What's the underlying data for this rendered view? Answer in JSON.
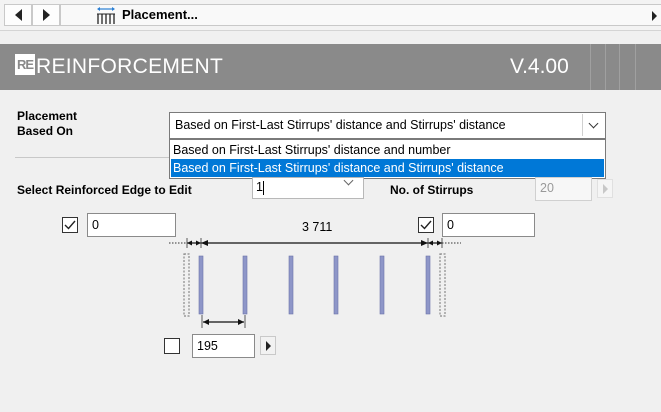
{
  "toolbar": {
    "title": "Placement..."
  },
  "banner": {
    "title": "REINFORCEMENT",
    "version": "V.4.00",
    "logo_text": "RE"
  },
  "placement": {
    "label_line1": "Placement",
    "label_line2": "Based On",
    "selected": "Based on First-Last Stirrups' distance and Stirrups' distance",
    "options": [
      "Based on First-Last Stirrups' distance and number",
      "Based on First-Last Stirrups' distance and Stirrups' distance"
    ],
    "selected_index": 1
  },
  "edge": {
    "label": "Select Reinforced Edge to Edit",
    "value": "1"
  },
  "stirrups": {
    "label": "No. of Stirrups",
    "value": "20"
  },
  "left_distance": {
    "checked": true,
    "value": "0"
  },
  "right_distance": {
    "checked": true,
    "value": "0"
  },
  "span_distance": {
    "value": "3 711"
  },
  "stirrup_spacing": {
    "checked": false,
    "value": "195"
  },
  "icons": [
    "back-arrow-icon",
    "forward-arrow-icon",
    "placement-icon",
    "chevron-down-icon",
    "checkmark-icon",
    "spin-right-icon"
  ]
}
